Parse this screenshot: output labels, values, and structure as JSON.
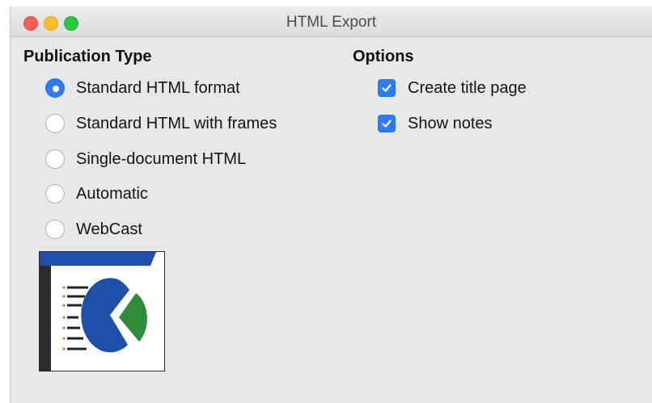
{
  "window": {
    "title": "HTML Export"
  },
  "publication_type": {
    "heading": "Publication Type",
    "options": [
      {
        "label": "Standard HTML format",
        "selected": true
      },
      {
        "label": "Standard HTML with frames",
        "selected": false
      },
      {
        "label": "Single-document HTML",
        "selected": false
      },
      {
        "label": "Automatic",
        "selected": false
      },
      {
        "label": "WebCast",
        "selected": false
      }
    ]
  },
  "options": {
    "heading": "Options",
    "items": [
      {
        "label": "Create title page",
        "checked": true
      },
      {
        "label": "Show notes",
        "checked": true
      }
    ]
  },
  "colors": {
    "accent": "#2f7bf6",
    "preview_banner": "#1f4fa8",
    "preview_pie_blue": "#1e50a8",
    "preview_pie_green": "#2e8b3a",
    "preview_bullets": "#e07a2a"
  }
}
